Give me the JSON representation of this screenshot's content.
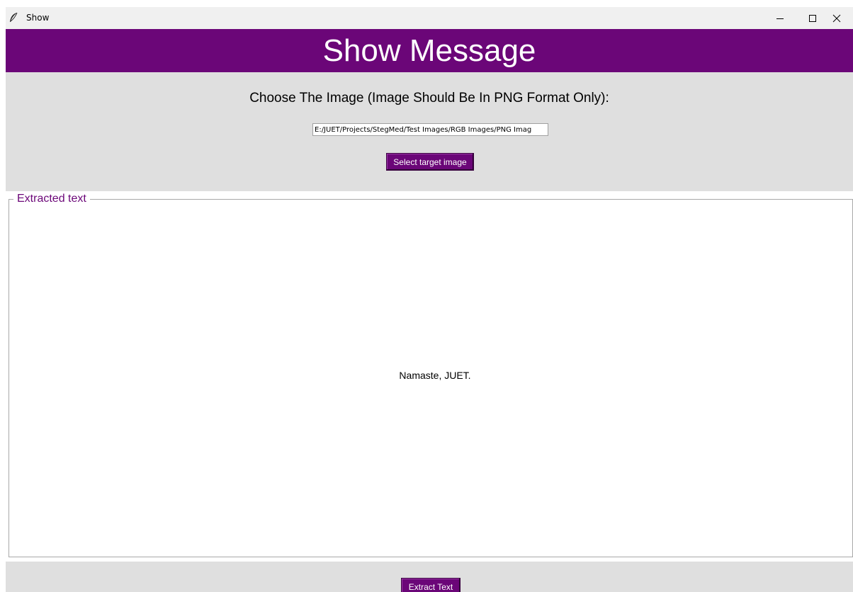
{
  "window": {
    "title": "Show",
    "controls": {
      "minimize_icon": "minimize-icon",
      "maximize_icon": "maximize-icon",
      "close_icon": "close-icon"
    }
  },
  "header": {
    "title": "Show Message",
    "background": "#6b0678"
  },
  "form": {
    "choose_label": "Choose The Image (Image Should Be In PNG Format Only):",
    "path_value": "E:/JUET/Projects/StegMed/Test Images/RGB Images/PNG Imag",
    "select_button_label": "Select target image"
  },
  "output": {
    "frame_label": "Extracted text",
    "extracted_text": "Namaste, JUET.",
    "extract_button_label": "Extract Text"
  },
  "colors": {
    "accent": "#6b0678",
    "window_bg": "#dfdfdf",
    "frame_bg": "#ffffff"
  }
}
